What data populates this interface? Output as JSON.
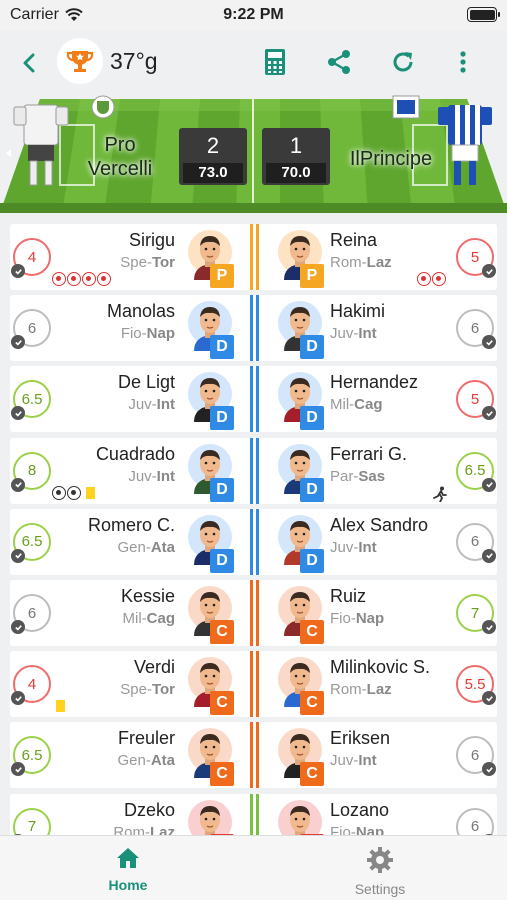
{
  "status_bar": {
    "carrier": "Carrier",
    "time": "9:22 PM"
  },
  "toolbar": {
    "round_label": "37°g",
    "icons": [
      "back-icon",
      "trophy-icon",
      "calculator-icon",
      "share-icon",
      "refresh-icon",
      "more-icon"
    ]
  },
  "match": {
    "home": {
      "name_line1": "Pro",
      "name_line2": "Vercelli",
      "goals": "2",
      "points": "73.0"
    },
    "away": {
      "name": "IlPrincipe",
      "goals": "1",
      "points": "70.0"
    }
  },
  "colors": {
    "accent": "#1a8f7a",
    "goalkeeper": "#f5a623",
    "defender": "#2f8ae5",
    "midfielder": "#f06a1c"
  },
  "rows": [
    {
      "home": {
        "name": "Sirigu",
        "team_a": "Spe-",
        "team_b": "Tor",
        "role": "P",
        "vote": "4",
        "vote_color": "red",
        "balls": 4,
        "ball_color": "red"
      },
      "away": {
        "name": "Reina",
        "team_a": "Rom-",
        "team_b": "Laz",
        "role": "P",
        "vote": "5",
        "vote_color": "red",
        "balls": 2,
        "ball_color": "red"
      },
      "bar": "#f5a623"
    },
    {
      "home": {
        "name": "Manolas",
        "team_a": "Fio-",
        "team_b": "Nap",
        "role": "D",
        "vote": "6",
        "vote_color": "grey"
      },
      "away": {
        "name": "Hakimi",
        "team_a": "Juv-",
        "team_b": "Int",
        "role": "D",
        "vote": "6",
        "vote_color": "grey"
      },
      "bar": "#2f8ae5"
    },
    {
      "home": {
        "name": "De Ligt",
        "team_a": "Juv-",
        "team_b": "Int",
        "role": "D",
        "vote": "6.5",
        "vote_color": "green"
      },
      "away": {
        "name": "Hernandez",
        "team_a": "Mil-",
        "team_b": "Cag",
        "role": "D",
        "vote": "5",
        "vote_color": "red"
      },
      "bar": "#2f8ae5"
    },
    {
      "home": {
        "name": "Cuadrado",
        "team_a": "Juv-",
        "team_b": "Int",
        "role": "D",
        "vote": "8",
        "vote_color": "green",
        "balls": 2,
        "ball_color": "black",
        "yellow": true
      },
      "away": {
        "name": "Ferrari G.",
        "team_a": "Par-",
        "team_b": "Sas",
        "role": "D",
        "vote": "6.5",
        "vote_color": "green",
        "runner": true
      },
      "bar": "#2f8ae5"
    },
    {
      "home": {
        "name": "Romero C.",
        "team_a": "Gen-",
        "team_b": "Ata",
        "role": "D",
        "vote": "6.5",
        "vote_color": "green"
      },
      "away": {
        "name": "Alex Sandro",
        "team_a": "Juv-",
        "team_b": "Int",
        "role": "D",
        "vote": "6",
        "vote_color": "grey"
      },
      "bar": "#2f8ae5"
    },
    {
      "home": {
        "name": "Kessie",
        "team_a": "Mil-",
        "team_b": "Cag",
        "role": "C",
        "vote": "6",
        "vote_color": "grey"
      },
      "away": {
        "name": "Ruiz",
        "team_a": "Fio-",
        "team_b": "Nap",
        "role": "C",
        "vote": "7",
        "vote_color": "green"
      },
      "bar": "#f06a1c"
    },
    {
      "home": {
        "name": "Verdi",
        "team_a": "Spe-",
        "team_b": "Tor",
        "role": "C",
        "vote": "4",
        "vote_color": "red",
        "yellow": true
      },
      "away": {
        "name": "Milinkovic S.",
        "team_a": "Rom-",
        "team_b": "Laz",
        "role": "C",
        "vote": "5.5",
        "vote_color": "red"
      },
      "bar": "#f06a1c"
    },
    {
      "home": {
        "name": "Freuler",
        "team_a": "Gen-",
        "team_b": "Ata",
        "role": "C",
        "vote": "6.5",
        "vote_color": "green"
      },
      "away": {
        "name": "Eriksen",
        "team_a": "Juv-",
        "team_b": "Int",
        "role": "C",
        "vote": "6",
        "vote_color": "grey"
      },
      "bar": "#f06a1c"
    },
    {
      "home": {
        "name": "Dzeko",
        "team_a": "Rom-",
        "team_b": "Laz",
        "role": "A",
        "vote": "7",
        "vote_color": "green"
      },
      "away": {
        "name": "Lozano",
        "team_a": "Fio-",
        "team_b": "Nap",
        "role": "A",
        "vote": "6",
        "vote_color": "grey"
      },
      "bar": "#7bc043"
    }
  ],
  "tabs": {
    "home": "Home",
    "settings": "Settings"
  }
}
